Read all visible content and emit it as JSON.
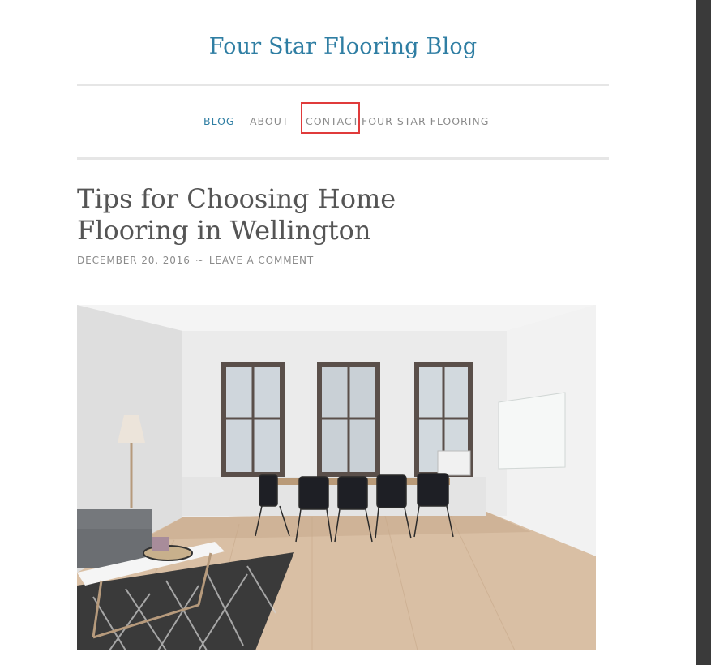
{
  "site": {
    "title": "Four Star Flooring Blog"
  },
  "nav": {
    "items": [
      {
        "label": "BLOG",
        "active": true
      },
      {
        "label": "ABOUT",
        "active": false
      },
      {
        "label": "CONTACT",
        "active": false
      },
      {
        "label": "FOUR STAR FLOORING",
        "active": false
      }
    ]
  },
  "post": {
    "title": "Tips for Choosing Home Flooring in Wellington",
    "date": "DECEMBER 20, 2016",
    "separator": "~",
    "comment_link": "LEAVE A COMMENT"
  },
  "colors": {
    "accent": "#2f7ea3",
    "highlight_box": "#e03b3b",
    "meta": "#8a8a8a"
  }
}
